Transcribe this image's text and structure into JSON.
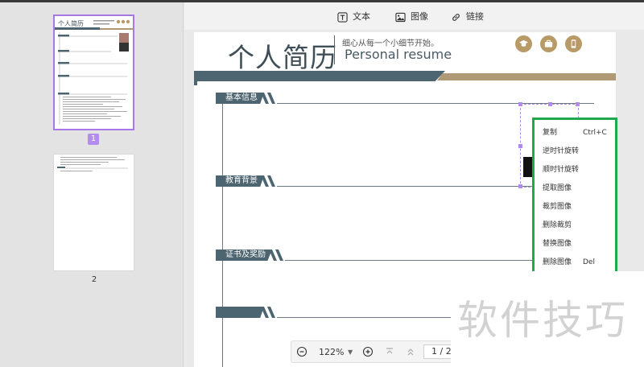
{
  "toolbar": {
    "text_label": "文本",
    "image_label": "图像",
    "link_label": "链接"
  },
  "thumbnails": {
    "page1_number": "1",
    "page2_number": "2",
    "page1_mini_title": "个人简历"
  },
  "resume": {
    "title": "个人简历",
    "subtitle_cn": "细心从每一个小细节开始。",
    "subtitle_en": "Personal resume",
    "sections": [
      "基本信息",
      "教育背景",
      "证书及奖励",
      ""
    ]
  },
  "context_menu": {
    "items": [
      {
        "label": "复制",
        "shortcut": "Ctrl+C"
      },
      {
        "label": "逆时针旋转",
        "shortcut": ""
      },
      {
        "label": "顺时针旋转",
        "shortcut": ""
      },
      {
        "label": "提取图像",
        "shortcut": ""
      },
      {
        "label": "裁剪图像",
        "shortcut": ""
      },
      {
        "label": "删除裁剪",
        "shortcut": ""
      },
      {
        "label": "替换图像",
        "shortcut": ""
      },
      {
        "label": "删除图像",
        "shortcut": "Del"
      }
    ]
  },
  "zoom": {
    "level": "122%",
    "page_input": "1 / 2"
  },
  "watermark": "软件技巧",
  "colors": {
    "accent_selection": "#b28ae8",
    "menu_border": "#20a84a",
    "resume_slate": "#4c6570",
    "resume_gold": "#b09a76"
  }
}
